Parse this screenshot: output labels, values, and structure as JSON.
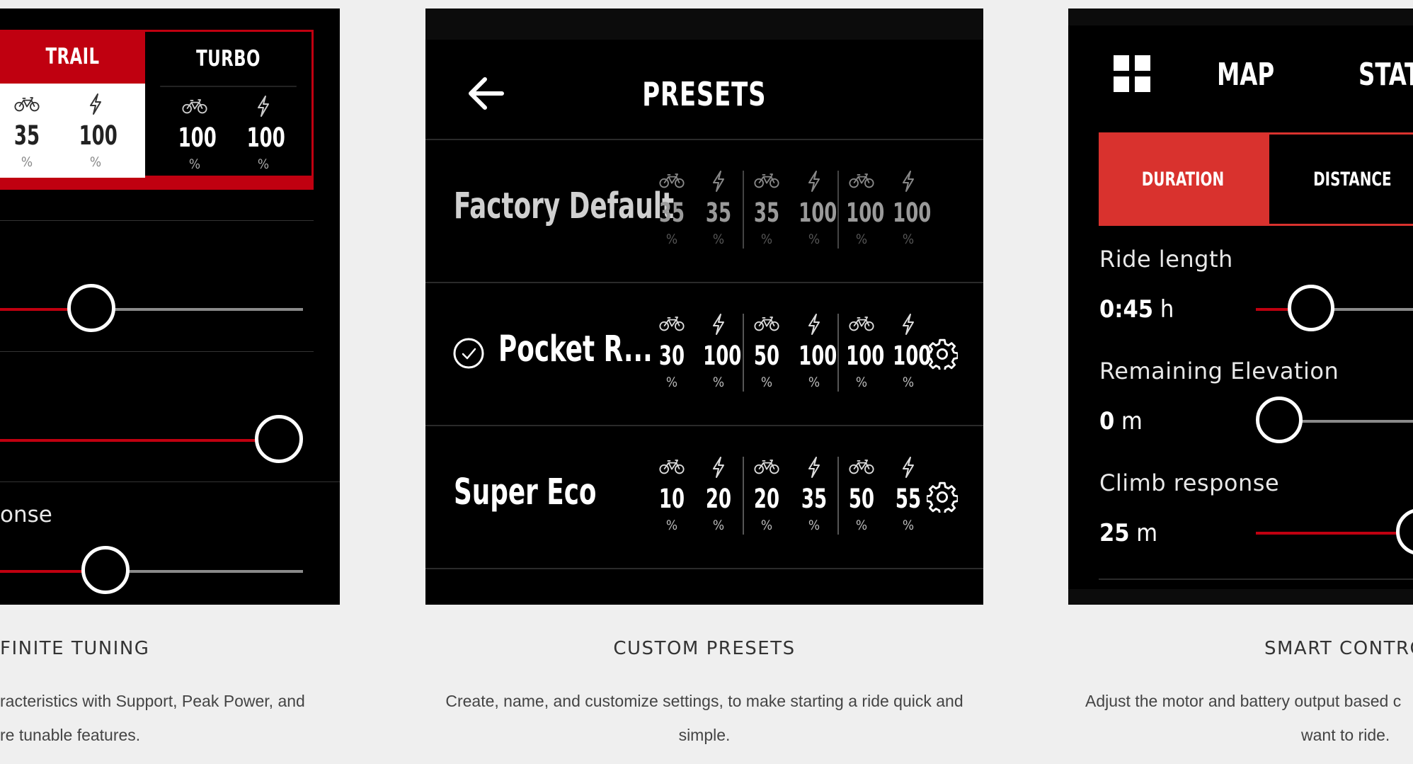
{
  "panel1": {
    "modes": [
      {
        "label": "TRAIL",
        "values": [
          {
            "icon": "bike-icon",
            "value": "35",
            "unit": "%"
          },
          {
            "icon": "bolt-icon",
            "value": "100",
            "unit": "%"
          }
        ]
      },
      {
        "label": "TURBO",
        "values": [
          {
            "icon": "bike-icon",
            "value": "100",
            "unit": "%"
          },
          {
            "icon": "bolt-icon",
            "value": "100",
            "unit": "%"
          }
        ]
      }
    ],
    "sliders": [
      {
        "level": 0.25
      },
      {
        "level": 0.92
      },
      {
        "level": 0.3
      }
    ],
    "partial_label": "onse"
  },
  "panel2": {
    "title": "PRESETS",
    "back_icon": "arrow-left-icon",
    "presets": [
      {
        "name": "Factory Default",
        "selected": false,
        "dimmed": true,
        "values": [
          "35",
          "35",
          "35",
          "100",
          "100",
          "100"
        ],
        "unit": "%",
        "settings": false
      },
      {
        "name": "Pocket R...",
        "selected": true,
        "dimmed": false,
        "values": [
          "30",
          "100",
          "50",
          "100",
          "100",
          "100"
        ],
        "unit": "%",
        "settings": true
      },
      {
        "name": "Super Eco",
        "selected": false,
        "dimmed": false,
        "values": [
          "10",
          "20",
          "20",
          "35",
          "50",
          "55"
        ],
        "unit": "%",
        "settings": true
      }
    ]
  },
  "panel3": {
    "nav": {
      "grid_icon": "grid-icon",
      "map": "MAP",
      "stats": "STAT"
    },
    "tabs": {
      "duration": "DURATION",
      "distance": "DISTANCE"
    },
    "settings": [
      {
        "label": "Ride length",
        "value": "0:45",
        "unit": "h",
        "level": 0.12
      },
      {
        "label": "Remaining Elevation",
        "value": "0",
        "unit": "m",
        "level": 0.0
      },
      {
        "label": "Climb response",
        "value": "25",
        "unit": "m",
        "level": 1.0
      }
    ]
  },
  "captions": [
    {
      "title": "FINITE TUNING",
      "line1": "racteristics with Support, Peak Power, and",
      "line2": "re tunable features."
    },
    {
      "title": "CUSTOM PRESETS",
      "line1": "Create, name, and customize settings, to make starting a ride quick and",
      "line2": "simple."
    },
    {
      "title": "SMART CONTRO",
      "line1": "Adjust the motor and battery output based c",
      "line2": "want to ride."
    }
  ],
  "colors": {
    "accent": "#c00010",
    "tab_active": "#d9322e",
    "background": "#efefef",
    "panel": "#000000"
  }
}
